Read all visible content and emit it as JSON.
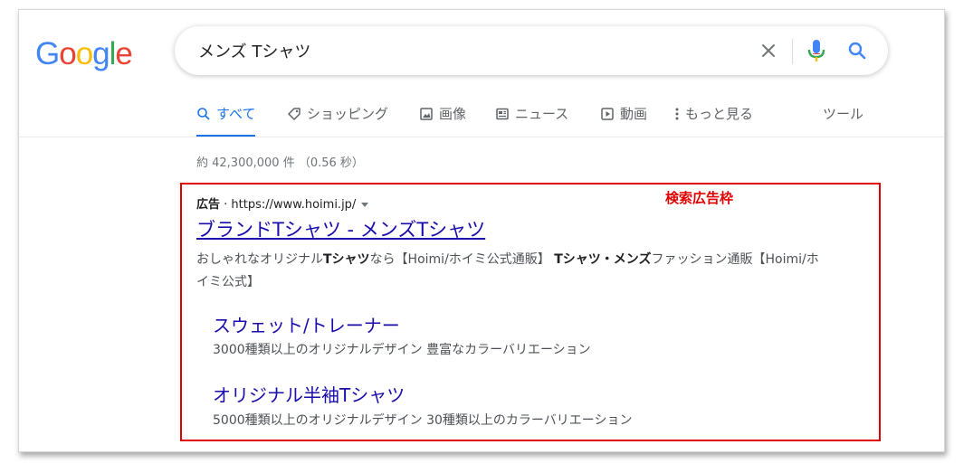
{
  "logo": {
    "letters": [
      {
        "ch": "G",
        "color": "#4285f4"
      },
      {
        "ch": "o",
        "color": "#ea4335"
      },
      {
        "ch": "o",
        "color": "#fbbc05"
      },
      {
        "ch": "g",
        "color": "#4285f4"
      },
      {
        "ch": "l",
        "color": "#34a853"
      },
      {
        "ch": "e",
        "color": "#ea4335"
      }
    ]
  },
  "search": {
    "query": "メンズ Tシャツ"
  },
  "tabs": {
    "all": "すべて",
    "shopping": "ショッピング",
    "images": "画像",
    "news": "ニュース",
    "videos": "動画",
    "more": "もっと見る",
    "tools": "ツール"
  },
  "stats": "約 42,300,000 件 （0.56 秒）",
  "annotation": {
    "label": "検索広告枠",
    "color": "#e00000"
  },
  "ad": {
    "badge": "広告",
    "separator": " · ",
    "url": "https://www.hoimi.jp/",
    "title": "ブランドTシャツ - メンズTシャツ",
    "desc": {
      "p1": "おしゃれなオリジナル",
      "b1": "Tシャツ",
      "p2": "なら【Hoimi/ホイミ公式通販】 ",
      "b2": "Tシャツ・メンズ",
      "p3": "ファッション通販【Hoimi/ホイミ公式】"
    },
    "sitelinks": [
      {
        "title": "スウェット/トレーナー",
        "desc": "3000種類以上のオリジナルデザイン 豊富なカラーバリエーション"
      },
      {
        "title": "オリジナル半袖Tシャツ",
        "desc": "5000種類以上のオリジナルデザイン 30種類以上のカラーバリエーション"
      }
    ]
  },
  "colors": {
    "accent": "#1a73e8",
    "link": "#1a0dab"
  }
}
